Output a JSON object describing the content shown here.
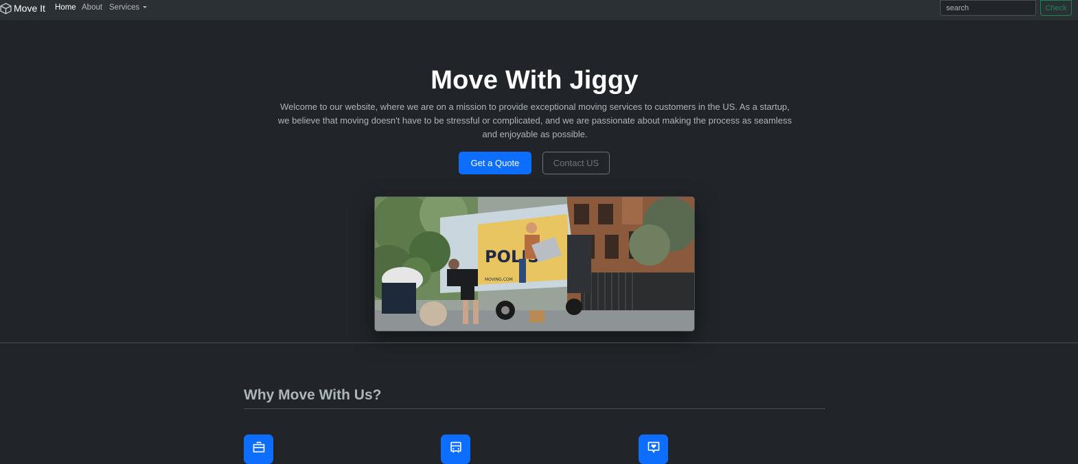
{
  "navbar": {
    "brand": "Move It",
    "brand_icon": "box-icon",
    "links": [
      {
        "label": "Home",
        "active": true
      },
      {
        "label": "About",
        "active": false
      },
      {
        "label": "Services",
        "active": false,
        "dropdown": true
      }
    ],
    "search": {
      "placeholder": "search",
      "value": ""
    },
    "check_button": "Check"
  },
  "hero": {
    "title": "Move With Jiggy",
    "description": "Welcome to our website, where we are on a mission to provide exceptional moving services to customers in the US. As a startup, we believe that moving doesn't have to be stressful or complicated, and we are passionate about making the process as seamless and enjoyable as possible.",
    "primary_button": "Get a Quote",
    "secondary_button": "Contact US",
    "image_text": {
      "truck_brand": "POLIS",
      "truck_url": "MOVING.COM"
    }
  },
  "features": {
    "title": "Why Move With Us?",
    "icons": [
      "briefcase-icon",
      "bus-icon",
      "chat-heart-icon"
    ]
  },
  "colors": {
    "background": "#212529",
    "navbar": "#2b3035",
    "primary": "#0d6efd",
    "success": "#198754",
    "secondary": "#6c757d"
  }
}
